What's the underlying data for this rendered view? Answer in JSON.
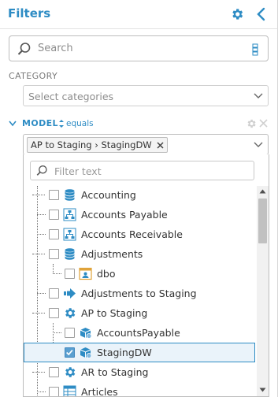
{
  "header": {
    "title": "Filters"
  },
  "search": {
    "placeholder": "Search"
  },
  "category": {
    "label": "CATEGORY",
    "placeholder": "Select categories"
  },
  "model": {
    "label": "MODEL",
    "operator": "equals",
    "selected_tag": "AP to Staging › StagingDW",
    "filter_placeholder": "Filter text",
    "tree": [
      {
        "label": "Accounting",
        "icon": "database-icon",
        "checked": false
      },
      {
        "label": "Accounts Payable",
        "icon": "hierarchy-icon",
        "checked": false
      },
      {
        "label": "Accounts Receivable",
        "icon": "hierarchy-icon",
        "checked": false
      },
      {
        "label": "Adjustments",
        "icon": "database-icon",
        "checked": false
      },
      {
        "label": "dbo",
        "icon": "schema-icon",
        "checked": false
      },
      {
        "label": "Adjustments to Staging",
        "icon": "arrow-right-icon",
        "checked": false
      },
      {
        "label": "AP to Staging",
        "icon": "gear-icon",
        "checked": false
      },
      {
        "label": "AccountsPayable",
        "icon": "package-icon",
        "checked": false
      },
      {
        "label": "StagingDW",
        "icon": "package-icon",
        "checked": true
      },
      {
        "label": "AR to Staging",
        "icon": "gear-icon",
        "checked": false
      },
      {
        "label": "Articles",
        "icon": "table-icon",
        "checked": false
      }
    ]
  },
  "colors": {
    "accent": "#2e8cc4",
    "selected_bg": "#eaf3fa"
  }
}
